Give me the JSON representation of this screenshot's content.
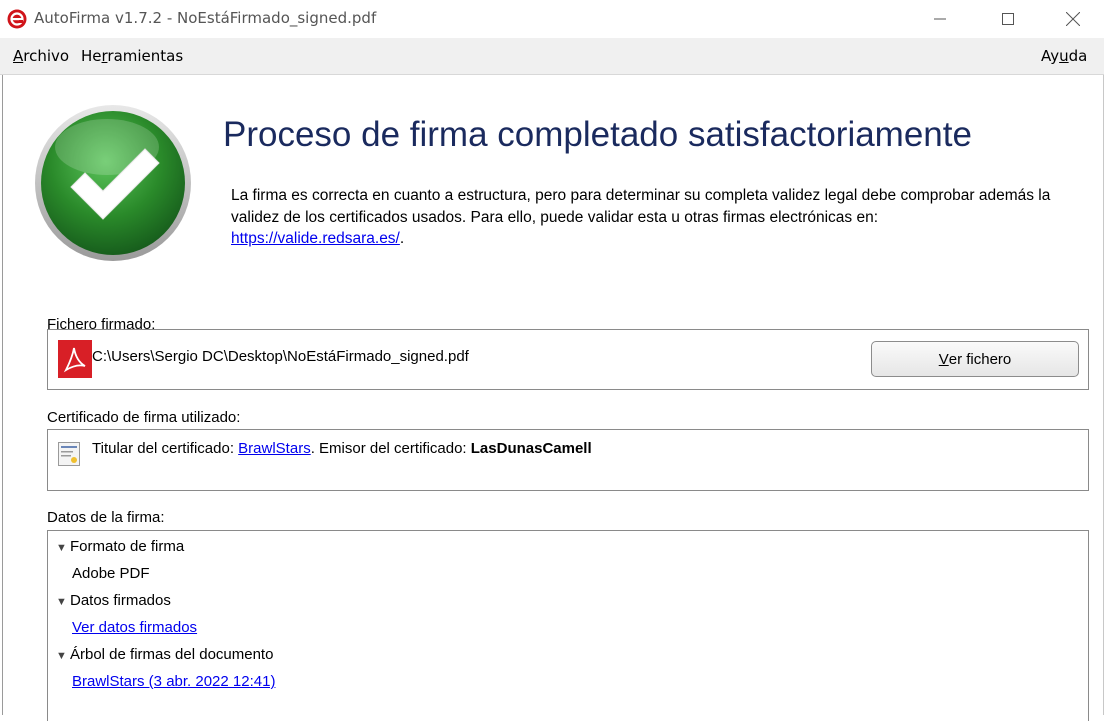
{
  "window": {
    "title": "AutoFirma v1.7.2 - NoEstáFirmado_signed.pdf"
  },
  "menu": {
    "archivo": {
      "first": "A",
      "rest": "rchivo"
    },
    "herramientas": {
      "before": "He",
      "u": "r",
      "after": "ramientas"
    },
    "ayuda": {
      "before": "Ay",
      "u": "u",
      "after": "da"
    }
  },
  "result": {
    "heading": "Proceso de firma completado satisfactoriamente",
    "description": "La firma es correcta en cuanto a estructura, pero para determinar su completa validez legal debe comprobar además la validez de los certificados usados. Para ello, puede validar esta u otras firmas electrónicas en:",
    "link": "https://valide.redsara.es/",
    "link_suffix": "."
  },
  "signed_file": {
    "label": "Fichero firmado:",
    "path": "C:\\Users\\Sergio DC\\Desktop\\NoEstáFirmado_signed.pdf",
    "button": {
      "u": "V",
      "rest": "er fichero"
    }
  },
  "certificate": {
    "label": "Certificado de firma utilizado:",
    "holder_prefix": "Titular del certificado: ",
    "holder": "BrawlStars",
    "issuer_prefix": ". Emisor del certificado: ",
    "issuer": "LasDunasCamell"
  },
  "signature_data": {
    "label": "Datos de la firma:",
    "nodes": [
      {
        "title": "Formato de firma",
        "child": "Adobe PDF",
        "child_is_link": false
      },
      {
        "title": "Datos firmados",
        "child": "Ver datos firmados",
        "child_is_link": true
      },
      {
        "title": "Árbol de firmas del documento",
        "child": "BrawlStars (3 abr. 2022 12:41)",
        "child_is_link": true
      }
    ]
  },
  "colors": {
    "heading": "#1a2a5e",
    "link": "#0000ee",
    "check_green": "#2e8b2e",
    "pdf_red": "#d81f26"
  }
}
